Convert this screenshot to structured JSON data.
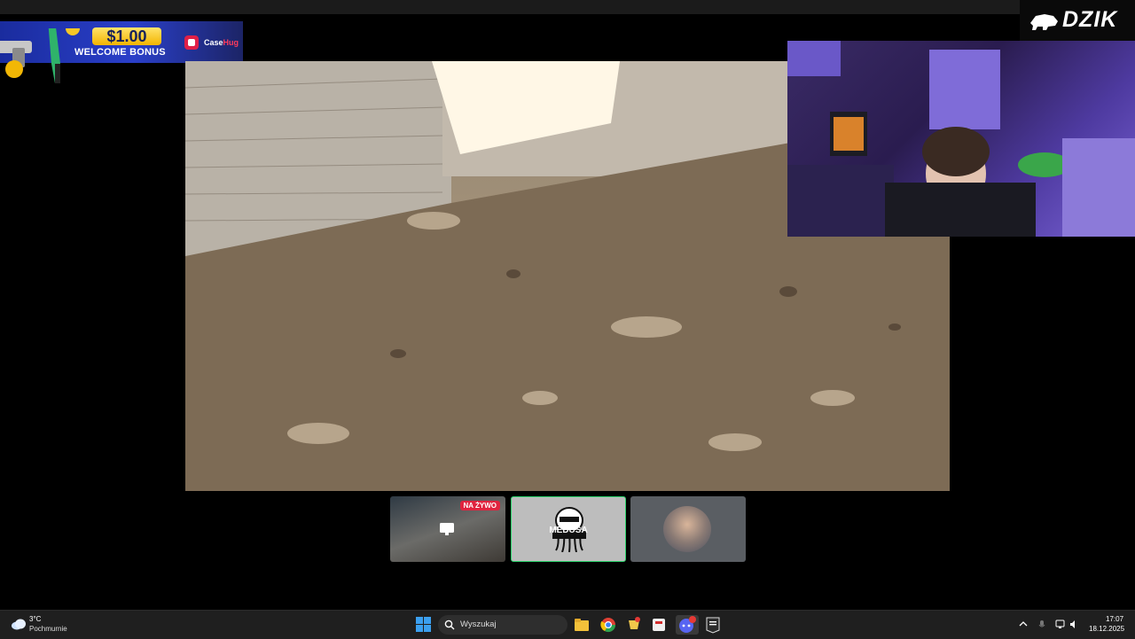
{
  "promo": {
    "amount": "$1.00",
    "label": "WELCOME BONUS",
    "brand_prefix": "Case",
    "brand_suffix": "Hug"
  },
  "streamer": {
    "name": "DZIK"
  },
  "participants": [
    {
      "badge": "NA ŻYWO",
      "icon": "screen-share-icon"
    },
    {
      "name": "MEDUSA",
      "icon": "medusa-logo-icon"
    },
    {
      "icon": "user-avatar"
    }
  ],
  "taskbar": {
    "weather": {
      "temp": "3°C",
      "desc": "Pochmurnie",
      "icon": "cloud-icon"
    },
    "search_placeholder": "Wyszukaj",
    "apps": [
      "start-icon",
      "file-explorer-icon",
      "chrome-icon",
      "app-icon",
      "app-icon",
      "discord-icon",
      "epic-games-icon"
    ],
    "time": "17:07",
    "date": "18.12.2025"
  },
  "colors": {
    "live_badge": "#e0243f",
    "active_tile_border": "#2bd26b",
    "taskbar": "#1f1f1f"
  }
}
